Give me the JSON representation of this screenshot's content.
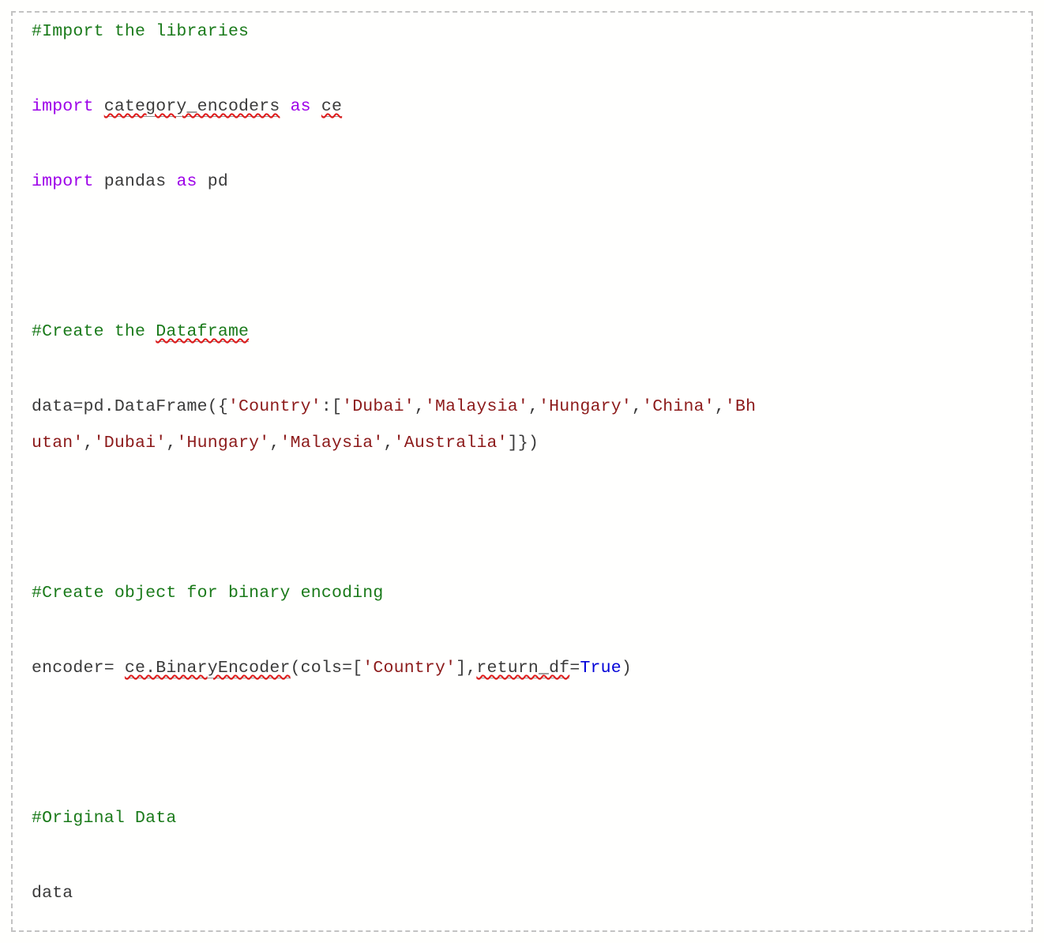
{
  "document": {
    "type": "code-snippet",
    "language": "python",
    "border_style": "dashed",
    "border_color": "#c3c3c3",
    "background": "#ffffff"
  },
  "colors": {
    "comment": "#1a7a1a",
    "keyword": "#9d00e8",
    "string": "#8c1a1a",
    "boolean": "#0000d8",
    "plain": "#3a3a3a",
    "spellcheck_underline": "#e01b1b"
  },
  "code": {
    "lines": [
      {
        "id": "comment-import-libraries",
        "kind": "comment",
        "tokens": [
          {
            "t": "#Import the libraries",
            "c": "cm"
          }
        ]
      },
      {
        "id": "blank-1",
        "kind": "blank",
        "tokens": []
      },
      {
        "id": "import-category-encoders",
        "kind": "code",
        "tokens": [
          {
            "t": "import ",
            "c": "kw"
          },
          {
            "t": "category_encoders",
            "c": "pln",
            "spell": true
          },
          {
            "t": " ",
            "c": "pln"
          },
          {
            "t": "as",
            "c": "kw"
          },
          {
            "t": " ",
            "c": "pln"
          },
          {
            "t": "ce",
            "c": "pln",
            "spell": true
          }
        ]
      },
      {
        "id": "blank-2",
        "kind": "blank",
        "tokens": []
      },
      {
        "id": "import-pandas",
        "kind": "code",
        "tokens": [
          {
            "t": "import ",
            "c": "kw"
          },
          {
            "t": "pandas ",
            "c": "pln"
          },
          {
            "t": "as",
            "c": "kw"
          },
          {
            "t": " pd",
            "c": "pln"
          }
        ]
      },
      {
        "id": "blank-3",
        "kind": "blank",
        "tokens": []
      },
      {
        "id": "blank-4",
        "kind": "blank",
        "tokens": []
      },
      {
        "id": "blank-5",
        "kind": "blank",
        "tokens": []
      },
      {
        "id": "comment-create-dataframe",
        "kind": "comment",
        "tokens": [
          {
            "t": "#Create the ",
            "c": "cm"
          },
          {
            "t": "Dataframe",
            "c": "cm",
            "spell": true
          }
        ]
      },
      {
        "id": "blank-6",
        "kind": "blank",
        "tokens": []
      },
      {
        "id": "create-dataframe-stmt",
        "kind": "code",
        "wrapped": true,
        "tokens": [
          {
            "t": "data=pd.DataFrame({",
            "c": "pln"
          },
          {
            "t": "'Country'",
            "c": "str"
          },
          {
            "t": ":[",
            "c": "pln"
          },
          {
            "t": "'Dubai'",
            "c": "str"
          },
          {
            "t": ",",
            "c": "pln"
          },
          {
            "t": "'Malaysia'",
            "c": "str"
          },
          {
            "t": ",",
            "c": "pln"
          },
          {
            "t": "'Hungary'",
            "c": "str"
          },
          {
            "t": ",",
            "c": "pln"
          },
          {
            "t": "'China'",
            "c": "str"
          },
          {
            "t": ",",
            "c": "pln"
          },
          {
            "t": "'Bhutan'",
            "c": "str"
          },
          {
            "t": ",",
            "c": "pln"
          },
          {
            "t": "'Dubai'",
            "c": "str"
          },
          {
            "t": ",",
            "c": "pln"
          },
          {
            "t": "'Hungary'",
            "c": "str"
          },
          {
            "t": ",",
            "c": "pln"
          },
          {
            "t": "'Malaysia'",
            "c": "str"
          },
          {
            "t": ",",
            "c": "pln"
          },
          {
            "t": "'Australia'",
            "c": "str"
          },
          {
            "t": "]})",
            "c": "pln"
          }
        ]
      },
      {
        "id": "blank-7",
        "kind": "blank",
        "tokens": []
      },
      {
        "id": "blank-8",
        "kind": "blank",
        "tokens": []
      },
      {
        "id": "blank-9",
        "kind": "blank",
        "tokens": []
      },
      {
        "id": "comment-create-object-binary-encoding",
        "kind": "comment",
        "tokens": [
          {
            "t": "#Create object for binary encoding",
            "c": "cm"
          }
        ]
      },
      {
        "id": "blank-10",
        "kind": "blank",
        "tokens": []
      },
      {
        "id": "encoder-stmt",
        "kind": "code",
        "tokens": [
          {
            "t": "encoder= ",
            "c": "pln"
          },
          {
            "t": "ce.BinaryEncoder",
            "c": "pln",
            "spell": true
          },
          {
            "t": "(cols=[",
            "c": "pln"
          },
          {
            "t": "'Country'",
            "c": "str"
          },
          {
            "t": "],",
            "c": "pln"
          },
          {
            "t": "return_df",
            "c": "pln",
            "spell": true
          },
          {
            "t": "=",
            "c": "pln"
          },
          {
            "t": "True",
            "c": "bool"
          },
          {
            "t": ")",
            "c": "pln"
          }
        ]
      },
      {
        "id": "blank-11",
        "kind": "blank",
        "tokens": []
      },
      {
        "id": "blank-12",
        "kind": "blank",
        "tokens": []
      },
      {
        "id": "blank-13",
        "kind": "blank",
        "tokens": []
      },
      {
        "id": "comment-original-data",
        "kind": "comment",
        "tokens": [
          {
            "t": "#Original Data",
            "c": "cm"
          }
        ]
      },
      {
        "id": "blank-14",
        "kind": "blank",
        "tokens": []
      },
      {
        "id": "data-expr",
        "kind": "code",
        "tokens": [
          {
            "t": "data",
            "c": "pln"
          }
        ]
      }
    ],
    "wrap": {
      "line_1": "data=pd.DataFrame({'Country':['Dubai','Malaysia','Hungary','China','Bhu",
      "line_2": "tan','Dubai','Hungary','Malaysia','Australia']})"
    }
  }
}
